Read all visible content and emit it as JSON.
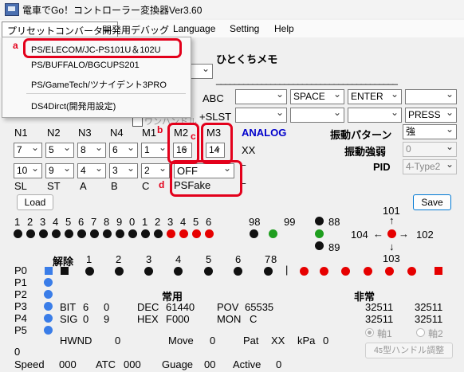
{
  "window": {
    "title": "電車でGo！コントローラー変換器Ver3.60"
  },
  "menu": {
    "items": [
      "プリセットコンバーター",
      "開発用デバッグ",
      "Language",
      "Setting",
      "Help"
    ]
  },
  "dropdown": {
    "items": [
      "PS/ELECOM/JC-PS101U＆102U",
      "PS/BUFFALO/BGCUPS201",
      "PS/GameTech/ツナイデント3PRO",
      "DS4Dirct(開発用設定)"
    ]
  },
  "annotations": {
    "a": "a",
    "b": "b",
    "c": "c",
    "d": "d"
  },
  "memo": {
    "label": "ひとくちメモ",
    "underline": "________________________________________"
  },
  "keymap": {
    "abc_label": "ABC",
    "slst_label": "+SLST",
    "wan_label": "ワンハンドル",
    "row1": [
      "",
      "SPACE",
      "ENTER",
      ""
    ],
    "row2": [
      "",
      "",
      "",
      "PRESS"
    ],
    "dashes": "----"
  },
  "notch_headers": [
    "N1",
    "N2",
    "N3",
    "N4",
    "M1",
    "M2",
    "M3"
  ],
  "notch_values": [
    "7",
    "5",
    "8",
    "6",
    "1",
    "16",
    "14"
  ],
  "notch_values2": [
    "10",
    "9",
    "4",
    "3",
    "2"
  ],
  "notch_footers": [
    "SL",
    "ST",
    "A",
    "B",
    "C"
  ],
  "analog": "ANALOG",
  "xx": "XX",
  "off_select": "OFF",
  "psfake": "PSFake",
  "dash": "–",
  "vibration": {
    "pattern_label": "振動パターン",
    "pattern_value": "強",
    "strength_label": "振動強弱",
    "strength_value": "0",
    "pid_label": "PID",
    "pid_value": "4-Type2"
  },
  "buttons": {
    "load": "Load",
    "save": "Save",
    "handle": "4ƽ型ハンドル調整"
  },
  "digits_row": [
    "1",
    "2",
    "3",
    "4",
    "5",
    "6",
    "7",
    "8",
    "9",
    "0",
    "1",
    "2",
    "3",
    "4",
    "5",
    "6"
  ],
  "digits_right": [
    "98",
    "99",
    "88",
    "89"
  ],
  "dpad": {
    "up": "101",
    "left": "104",
    "right": "102",
    "down": "103",
    "left_arrow": "←",
    "right_arrow": "→",
    "up_arrow": "↑",
    "down_arrow": "↓"
  },
  "dot_states": [
    "off",
    "off",
    "off",
    "off",
    "off",
    "off",
    "off",
    "off",
    "off",
    "off",
    "off",
    "off",
    "on",
    "on",
    "on",
    "on"
  ],
  "colors": {
    "red": "#e60000",
    "green": "#1f9e1f",
    "blue": "#3a7de8",
    "black": "#111111",
    "label_blue": "#0000cc"
  },
  "kaijo": {
    "label": "解除",
    "numbers": [
      "1",
      "2",
      "3",
      "4",
      "5",
      "6",
      "7",
      "8"
    ],
    "sep": "|"
  },
  "ports": [
    "P0",
    "P1",
    "P2",
    "P3",
    "P4",
    "P5"
  ],
  "status": {
    "bit_label": "BIT",
    "bit_a": "6",
    "bit_b": "0",
    "sig_label": "SIG",
    "sig_a": "0",
    "sig_b": "9",
    "hwnd_label": "HWND",
    "hwnd_val": "0",
    "joyo": "常用",
    "hijo": "非常",
    "dec_label": "DEC",
    "dec_val": "61440",
    "hex_label": "HEX",
    "hex_val": "F000",
    "pov_label": "POV",
    "pov_val": "65535",
    "mon_label": "MON",
    "mon_val": "C",
    "nums1": [
      "32511",
      "32511"
    ],
    "nums2": [
      "32511",
      "32511"
    ],
    "axis1": "軸1",
    "axis2": "軸2",
    "move_label": "Move",
    "move_val": "0",
    "pat_label": "Pat",
    "pat_val": "XX",
    "kpa_label": "kPa",
    "kpa_val": "0",
    "zero": "0",
    "speed_label": "Speed",
    "speed_val": "000",
    "atc_label": "ATC",
    "atc_val": "000",
    "guage_label": "Guage",
    "guage_val": "00",
    "active_label": "Active",
    "active_val": "0"
  }
}
